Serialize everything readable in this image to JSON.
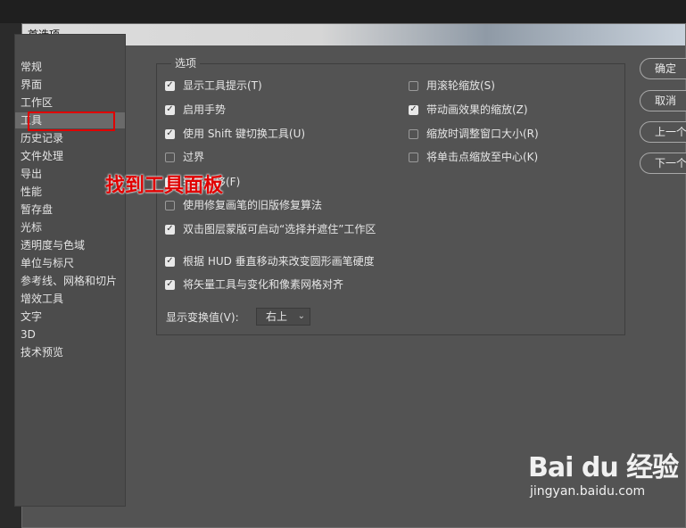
{
  "dialog": {
    "title": "首选项"
  },
  "sidebar": {
    "items": [
      {
        "label": "常规"
      },
      {
        "label": "界面"
      },
      {
        "label": "工作区"
      },
      {
        "label": "工具"
      },
      {
        "label": "历史记录"
      },
      {
        "label": "文件处理"
      },
      {
        "label": "导出"
      },
      {
        "label": "性能"
      },
      {
        "label": "暂存盘"
      },
      {
        "label": "光标"
      },
      {
        "label": "透明度与色域"
      },
      {
        "label": "单位与标尺"
      },
      {
        "label": "参考线、网格和切片"
      },
      {
        "label": "增效工具"
      },
      {
        "label": "文字"
      },
      {
        "label": "3D"
      },
      {
        "label": "技术预览"
      }
    ],
    "selected": "工具"
  },
  "options": {
    "legend": "选项",
    "left": [
      {
        "label": "显示工具提示(T)",
        "checked": true
      },
      {
        "label": "启用手势",
        "checked": true
      },
      {
        "label": "使用 Shift 键切换工具(U)",
        "checked": true
      },
      {
        "label": "过界",
        "checked": false
      },
      {
        "label": "轻击平移(F)",
        "checked": true
      },
      {
        "label": "使用修复画笔的旧版修复算法",
        "checked": false
      },
      {
        "label": "双击图层蒙版可启动“选择并遮住”工作区",
        "checked": true
      },
      {
        "label": "根据 HUD 垂直移动来改变圆形画笔硬度",
        "checked": true
      },
      {
        "label": "将矢量工具与变化和像素网格对齐",
        "checked": true
      }
    ],
    "right": [
      {
        "label": "用滚轮缩放(S)",
        "checked": false
      },
      {
        "label": "带动画效果的缩放(Z)",
        "checked": true
      },
      {
        "label": "缩放时调整窗口大小(R)",
        "checked": false
      },
      {
        "label": "将单击点缩放至中心(K)",
        "checked": false
      }
    ],
    "transform": {
      "label": "显示变换值(V):",
      "value": "右上"
    }
  },
  "buttons": {
    "ok": "确定",
    "cancel": "取消",
    "prev": "上一个",
    "next": "下一个"
  },
  "annotation": {
    "text": "找到工具面板",
    "color": "#e00000"
  },
  "watermark": {
    "logo": "Bai du 经验",
    "sub": "jingyan.baidu.com"
  },
  "colors": {
    "panel": "#535353",
    "highlight": "#e00000"
  }
}
